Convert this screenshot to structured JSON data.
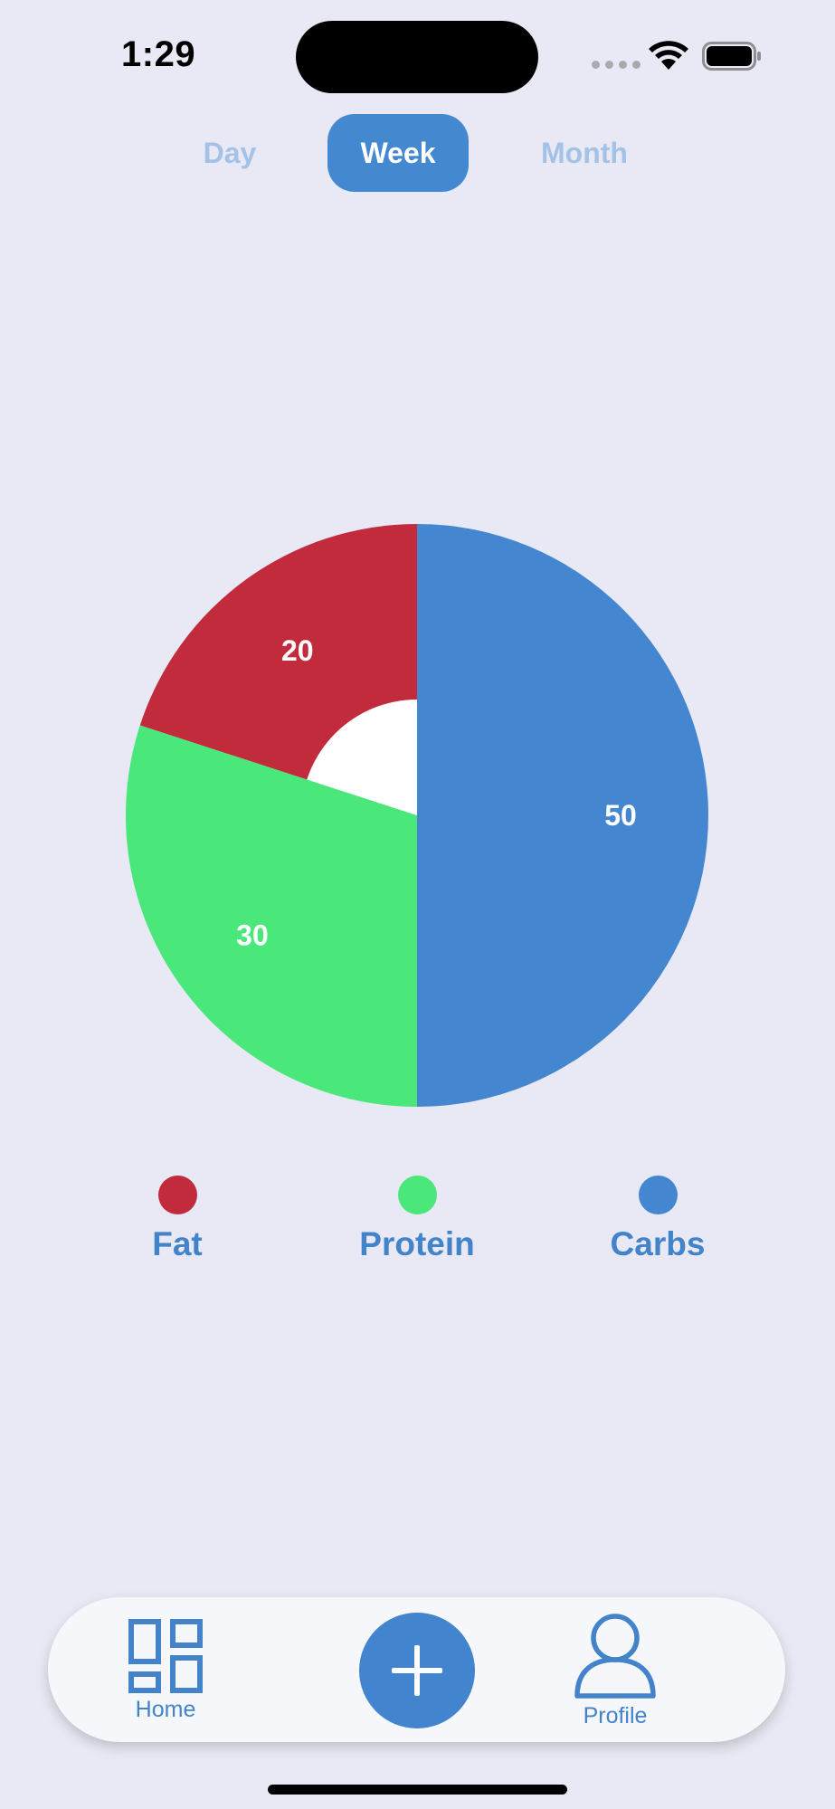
{
  "status_bar": {
    "time": "1:29"
  },
  "segments": {
    "items": [
      "Day",
      "Week",
      "Month"
    ],
    "selected": "Week"
  },
  "chart_data": {
    "type": "pie",
    "variant": "donut",
    "categories": [
      "Fat",
      "Protein",
      "Carbs"
    ],
    "values": [
      20,
      30,
      50
    ],
    "colors": [
      "#C22B3C",
      "#4AE77B",
      "#4487D0"
    ],
    "data_labels": [
      "20",
      "30",
      "50"
    ],
    "legend_position": "bottom"
  },
  "legend": {
    "items": [
      {
        "label": "Fat",
        "color": "#C22B3C"
      },
      {
        "label": "Protein",
        "color": "#4AE77B"
      },
      {
        "label": "Carbs",
        "color": "#4487D0"
      }
    ]
  },
  "tab_bar": {
    "home_label": "Home",
    "profile_label": "Profile",
    "home_icon": "dashboard-grid-icon",
    "add_icon": "plus-icon",
    "profile_icon": "person-icon"
  },
  "colors": {
    "background": "#E8E9F4",
    "accent": "#4384CF",
    "inactive_segment_text": "#A4C2E6",
    "donut_hole": "#FFFFFF"
  }
}
